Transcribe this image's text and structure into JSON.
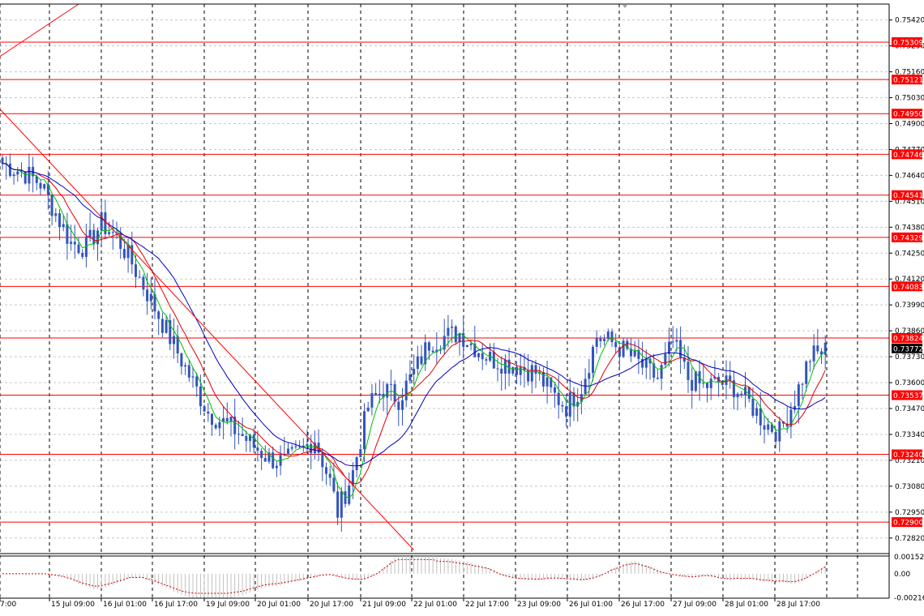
{
  "chart_data": [
    {
      "type": "candlestick",
      "symbol_note": "",
      "ylim": [
        0.7275,
        0.755
      ],
      "y_tick_labels": [
        "0.75420",
        "0.75290",
        "0.75160",
        "0.75030",
        "0.74900",
        "0.74770",
        "0.74640",
        "0.74510",
        "0.74380",
        "0.74250",
        "0.74120",
        "0.73990",
        "0.73860",
        "0.73730",
        "0.73600",
        "0.73470",
        "0.73340",
        "0.73210",
        "0.73080",
        "0.72950",
        "0.72820"
      ],
      "x_tick_labels": [
        "15 Jul 01:00",
        "15 Jul 09:00",
        "16 Jul 01:00",
        "16 Jul 17:00",
        "19 Jul 09:00",
        "20 Jul 01:00",
        "20 Jul 17:00",
        "21 Jul 09:00",
        "22 Jul 01:00",
        "22 Jul 17:00",
        "23 Jul 09:00",
        "26 Jul 01:00",
        "26 Jul 17:00",
        "27 Jul 09:00",
        "28 Jul 01:00",
        "28 Jul 17:00"
      ],
      "x_tick_displayed": [
        "7:00",
        "15 Jul 09:00",
        "16 Jul 01:00",
        "16 Jul 17:00",
        "19 Jul 09:00",
        "20 Jul 01:00",
        "20 Jul 17:00",
        "21 Jul 09:00",
        "22 Jul 01:00",
        "22 Jul 17:00",
        "23 Jul 09:00",
        "26 Jul 01:00",
        "26 Jul 17:00",
        "27 Jul 09:00",
        "28 Jul 01:00",
        "28 Jul 17:00"
      ],
      "horizontal_levels": [
        "0.75309",
        "0.75121",
        "0.74950",
        "0.74746",
        "0.74541",
        "0.74329",
        "0.74083",
        "0.73824",
        "0.73537",
        "0.73240",
        "0.72900"
      ],
      "current_price": "0.73772",
      "price_path_keypoints": [
        [
          0,
          0.747
        ],
        [
          6,
          0.7465
        ],
        [
          10,
          0.746
        ],
        [
          14,
          0.7445
        ],
        [
          18,
          0.743
        ],
        [
          22,
          0.7428
        ],
        [
          26,
          0.744
        ],
        [
          30,
          0.7433
        ],
        [
          34,
          0.742
        ],
        [
          38,
          0.7405
        ],
        [
          42,
          0.739
        ],
        [
          46,
          0.7375
        ],
        [
          50,
          0.736
        ],
        [
          54,
          0.7345
        ],
        [
          58,
          0.734
        ],
        [
          62,
          0.7335
        ],
        [
          66,
          0.7328
        ],
        [
          70,
          0.7322
        ],
        [
          74,
          0.732
        ],
        [
          78,
          0.7325
        ],
        [
          82,
          0.7332
        ],
        [
          86,
          0.731
        ],
        [
          88,
          0.7295
        ],
        [
          92,
          0.7315
        ],
        [
          96,
          0.7348
        ],
        [
          100,
          0.7357
        ],
        [
          104,
          0.7352
        ],
        [
          108,
          0.7365
        ],
        [
          112,
          0.738
        ],
        [
          116,
          0.7383
        ],
        [
          120,
          0.7385
        ],
        [
          124,
          0.7378
        ],
        [
          128,
          0.7372
        ],
        [
          132,
          0.737
        ],
        [
          136,
          0.7368
        ],
        [
          140,
          0.7365
        ],
        [
          144,
          0.7355
        ],
        [
          148,
          0.7348
        ],
        [
          152,
          0.7358
        ],
        [
          156,
          0.7383
        ],
        [
          160,
          0.738
        ],
        [
          164,
          0.7375
        ],
        [
          168,
          0.7368
        ],
        [
          172,
          0.7362
        ],
        [
          176,
          0.738
        ],
        [
          180,
          0.7362
        ],
        [
          184,
          0.7358
        ],
        [
          188,
          0.736
        ],
        [
          192,
          0.7358
        ],
        [
          196,
          0.735
        ],
        [
          200,
          0.734
        ],
        [
          204,
          0.7335
        ],
        [
          208,
          0.7352
        ],
        [
          212,
          0.7373
        ],
        [
          216,
          0.7376
        ]
      ],
      "bar_count": 217,
      "moving_averages": [
        {
          "period": 5,
          "color": "#00c000"
        },
        {
          "period": 10,
          "color": "#e00000"
        },
        {
          "period": 20,
          "color": "#0000c0"
        }
      ],
      "trendlines": [
        {
          "from": [
            -2,
            0.75
          ],
          "to": [
            108,
            0.7276
          ],
          "color": "#ff0000"
        },
        {
          "from": [
            -2,
            0.7522
          ],
          "to": [
            20,
            0.755
          ],
          "color": "#ff0000"
        }
      ],
      "colors": {
        "candle": "#3355bb",
        "level": "#ff0000",
        "grid": "#c8c8c8",
        "vgrid": "#000000"
      }
    },
    {
      "type": "histogram",
      "ylim": [
        -0.0022,
        0.0016
      ],
      "y_tick_labels": [
        "0.001523",
        "0.00",
        "-0.00216"
      ],
      "signal_color": "#cc0000",
      "bars_color": "#c0c0c0"
    }
  ]
}
